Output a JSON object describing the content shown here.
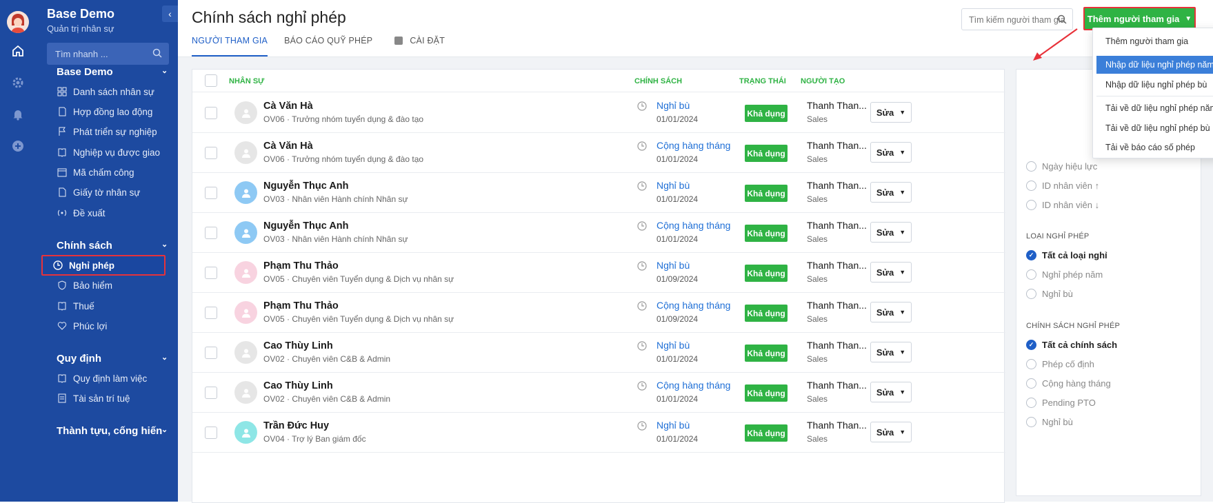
{
  "app": {
    "name": "Base Demo",
    "subtitle": "Quản trị nhân sự",
    "collapse_icon": "chevron-left-icon"
  },
  "sidebar": {
    "search_placeholder": "Tìm nhanh ...",
    "sections": [
      {
        "title": "Base Demo",
        "items": [
          "Danh sách nhân sự",
          "Hợp đồng lao động",
          "Phát triển sự nghiệp",
          "Nghiệp vụ được giao",
          "Mã chấm công",
          "Giấy tờ nhân sự",
          "Đề xuất"
        ]
      },
      {
        "title": "Chính sách",
        "items": [
          "Nghỉ phép",
          "Bảo hiểm",
          "Thuế",
          "Phúc lợi"
        ]
      },
      {
        "title": "Quy định",
        "items": [
          "Quy định làm việc",
          "Tài sản trí tuệ"
        ]
      },
      {
        "title": "Thành tựu, cống hiến",
        "items": []
      }
    ]
  },
  "header": {
    "title": "Chính sách nghỉ phép",
    "tabs": [
      "NGƯỜI THAM GIA",
      "BÁO CÁO QUỸ PHÉP",
      "CÀI ĐẶT"
    ],
    "search_placeholder": "Tìm kiếm người tham gia",
    "add_button": "Thêm người tham gia"
  },
  "dropdown": {
    "items": [
      "Thêm người tham gia",
      "Nhập dữ liệu nghỉ phép năm",
      "Nhập dữ liệu nghỉ phép bù",
      "Tải về dữ liệu nghỉ phép năm",
      "Tải về dữ liệu nghỉ phép bù",
      "Tải về báo cáo số phép"
    ],
    "highlighted": "Nhập dữ liệu nghỉ phép năm"
  },
  "table": {
    "columns": [
      "NHÂN SỰ",
      "CHÍNH SÁCH",
      "TRẠNG THÁI",
      "NGƯỜI TẠO"
    ],
    "rows": [
      {
        "name": "Cà Văn Hà",
        "desc": "OV06 · Trưởng nhóm tuyển dụng & đào tạo",
        "policy": "Nghỉ bù",
        "date": "01/01/2024",
        "status": "Khả dụng",
        "creator": "Thanh Than...",
        "dept": "Sales",
        "edit": "Sửa",
        "avatar": "#e6e6e6"
      },
      {
        "name": "Cà Văn Hà",
        "desc": "OV06 · Trưởng nhóm tuyển dụng & đào tạo",
        "policy": "Cộng hàng tháng",
        "date": "01/01/2024",
        "status": "Khả dụng",
        "creator": "Thanh Than...",
        "dept": "Sales",
        "edit": "Sửa",
        "avatar": "#e6e6e6"
      },
      {
        "name": "Nguyễn Thục Anh",
        "desc": "OV03 · Nhân viên Hành chính Nhân sự",
        "policy": "Nghỉ bù",
        "date": "01/01/2024",
        "status": "Khả dụng",
        "creator": "Thanh Than...",
        "dept": "Sales",
        "edit": "Sửa",
        "avatar": "#8ec9f4"
      },
      {
        "name": "Nguyễn Thục Anh",
        "desc": "OV03 · Nhân viên Hành chính Nhân sự",
        "policy": "Cộng hàng tháng",
        "date": "01/01/2024",
        "status": "Khả dụng",
        "creator": "Thanh Than...",
        "dept": "Sales",
        "edit": "Sửa",
        "avatar": "#8ec9f4"
      },
      {
        "name": "Phạm Thu Thảo",
        "desc": "OV05 · Chuyên viên Tuyển dụng & Dịch vụ nhân sự",
        "policy": "Nghỉ bù",
        "date": "01/09/2024",
        "status": "Khả dụng",
        "creator": "Thanh Than...",
        "dept": "Sales",
        "edit": "Sửa",
        "avatar": "#f8d3e0"
      },
      {
        "name": "Phạm Thu Thảo",
        "desc": "OV05 · Chuyên viên Tuyển dụng & Dịch vụ nhân sự",
        "policy": "Cộng hàng tháng",
        "date": "01/09/2024",
        "status": "Khả dụng",
        "creator": "Thanh Than...",
        "dept": "Sales",
        "edit": "Sửa",
        "avatar": "#f8d3e0"
      },
      {
        "name": "Cao Thùy Linh",
        "desc": "OV02 · Chuyên viên C&B & Admin",
        "policy": "Nghỉ bù",
        "date": "01/01/2024",
        "status": "Khả dụng",
        "creator": "Thanh Than...",
        "dept": "Sales",
        "edit": "Sửa",
        "avatar": "#e6e6e6"
      },
      {
        "name": "Cao Thùy Linh",
        "desc": "OV02 · Chuyên viên C&B & Admin",
        "policy": "Cộng hàng tháng",
        "date": "01/01/2024",
        "status": "Khả dụng",
        "creator": "Thanh Than...",
        "dept": "Sales",
        "edit": "Sửa",
        "avatar": "#e6e6e6"
      },
      {
        "name": "Trần Đức Huy",
        "desc": "OV04 · Trợ lý Ban giám đốc",
        "policy": "Nghỉ bù",
        "date": "01/01/2024",
        "status": "Khả dụng",
        "creator": "Thanh Than...",
        "dept": "Sales",
        "edit": "Sửa",
        "avatar": "#8ee6e6"
      }
    ]
  },
  "filters": {
    "sort_options": [
      "Ngày hiệu lực",
      "ID nhân viên ↑",
      "ID nhân viên ↓"
    ],
    "leave_type": {
      "title": "LOẠI NGHỈ PHÉP",
      "options": [
        "Tất cả loại nghỉ",
        "Nghỉ phép năm",
        "Nghỉ bù"
      ],
      "selected": "Tất cả loại nghỉ"
    },
    "leave_policy": {
      "title": "CHÍNH SÁCH NGHỈ PHÉP",
      "options": [
        "Tất cả chính sách",
        "Phép cố định",
        "Cộng hàng tháng",
        "Pending PTO",
        "Nghỉ bù"
      ],
      "selected": "Tất cả chính sách"
    }
  },
  "colors": {
    "sidebar": "#1d4aa0",
    "accent": "#1f5fc7",
    "green": "#2fb344",
    "red_highlight": "#e8323a"
  }
}
